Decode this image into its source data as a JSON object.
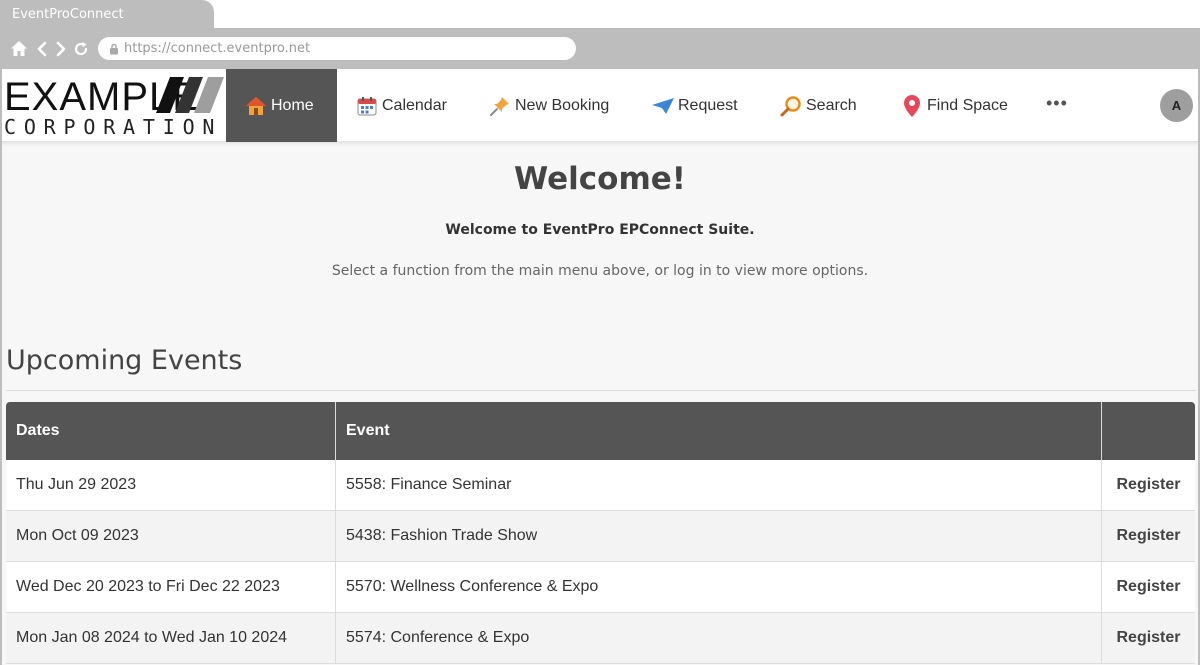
{
  "browser": {
    "tab_title": "EventProConnect",
    "url": "https://connect.eventpro.net"
  },
  "logo": {
    "line1": "EXAMPLE",
    "line2": "CORPORATION"
  },
  "nav": {
    "items": [
      {
        "label": "Home",
        "icon": "house-icon"
      },
      {
        "label": "Calendar",
        "icon": "calendar-icon"
      },
      {
        "label": "New Booking",
        "icon": "pushpin-icon"
      },
      {
        "label": "Request",
        "icon": "paper-plane-icon"
      },
      {
        "label": "Search",
        "icon": "magnifier-icon"
      },
      {
        "label": "Find Space",
        "icon": "map-pin-icon"
      }
    ],
    "more": "•••",
    "avatar": "A"
  },
  "welcome": {
    "title": "Welcome!",
    "subtitle": "Welcome to EventPro EPConnect Suite.",
    "text": "Select a function from the main menu above, or log in to view more options."
  },
  "events": {
    "heading": "Upcoming Events",
    "columns": [
      "Dates",
      "Event",
      ""
    ],
    "rows": [
      {
        "dates": "Thu Jun 29 2023",
        "event": "5558: Finance Seminar",
        "action": "Register"
      },
      {
        "dates": "Mon Oct 09 2023",
        "event": "5438: Fashion Trade Show",
        "action": "Register"
      },
      {
        "dates": "Wed Dec 20 2023 to Fri Dec 22 2023",
        "event": "5570: Wellness Conference & Expo",
        "action": "Register"
      },
      {
        "dates": "Mon Jan 08 2024 to Wed Jan 10 2024",
        "event": "5574: Conference & Expo",
        "action": "Register"
      }
    ]
  },
  "colors": {
    "chrome": "#bdbdbd",
    "nav_active": "#555555",
    "table_header": "#555555"
  }
}
